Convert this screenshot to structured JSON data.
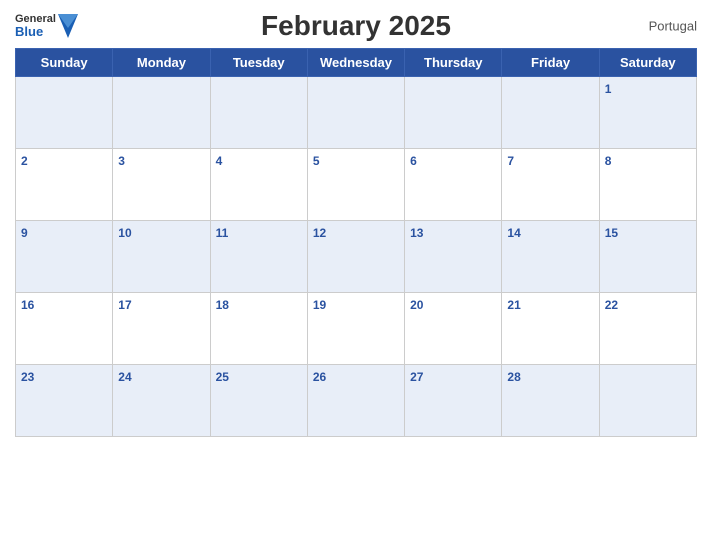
{
  "header": {
    "logo_general": "General",
    "logo_blue": "Blue",
    "title": "February 2025",
    "country": "Portugal"
  },
  "weekdays": [
    "Sunday",
    "Monday",
    "Tuesday",
    "Wednesday",
    "Thursday",
    "Friday",
    "Saturday"
  ],
  "weeks": [
    [
      null,
      null,
      null,
      null,
      null,
      null,
      1
    ],
    [
      2,
      3,
      4,
      5,
      6,
      7,
      8
    ],
    [
      9,
      10,
      11,
      12,
      13,
      14,
      15
    ],
    [
      16,
      17,
      18,
      19,
      20,
      21,
      22
    ],
    [
      23,
      24,
      25,
      26,
      27,
      28,
      null
    ]
  ]
}
